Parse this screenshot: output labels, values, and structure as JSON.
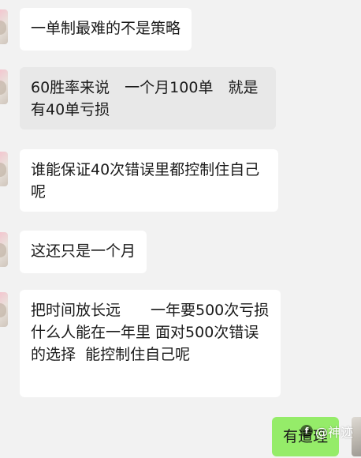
{
  "messages": [
    {
      "text": "一单制最难的不是策略"
    },
    {
      "text": "60胜率来说　一个月100单　就是有40单亏损"
    },
    {
      "text": "谁能保证40次错误里都控制住自己呢"
    },
    {
      "text": "这还只是一个月"
    },
    {
      "text": "把时间放长远　　一年要500次亏损　　什么人能在一年里 面对500次错误的选择  能控制住自己呢"
    }
  ],
  "reply": {
    "text": "有道理"
  },
  "watermark": {
    "symbol": "f",
    "handle": "@神迹"
  },
  "colors": {
    "background": "#f2f2f2",
    "incoming_bubble": "#ffffff",
    "incoming_bubble_selected": "#e8e8e8",
    "outgoing_bubble": "#95ec69"
  }
}
